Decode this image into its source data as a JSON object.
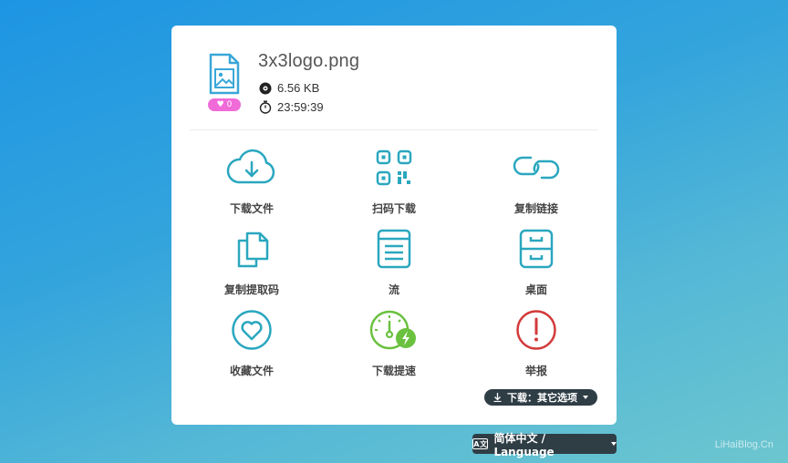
{
  "file": {
    "name": "3x3logo.png",
    "size": "6.56 KB",
    "countdown": "23:59:39",
    "likes": "0"
  },
  "actions": [
    {
      "label": "下载文件",
      "icon": "cloud-download-icon"
    },
    {
      "label": "扫码下载",
      "icon": "qr-code-icon"
    },
    {
      "label": "复制链接",
      "icon": "link-icon"
    },
    {
      "label": "复制提取码",
      "icon": "copy-icon"
    },
    {
      "label": "流",
      "icon": "document-icon"
    },
    {
      "label": "桌面",
      "icon": "cabinet-icon"
    },
    {
      "label": "收藏文件",
      "icon": "heart-icon"
    },
    {
      "label": "下载提速",
      "icon": "speedometer-icon"
    },
    {
      "label": "举报",
      "icon": "alert-icon"
    }
  ],
  "more_options_label": "下载：其它选项",
  "language_label": "简体中文 / Language",
  "watermark": "LiHaiBlog.Cn",
  "colors": {
    "teal": "#2aa7bf",
    "green": "#6ac13f",
    "red": "#d33a3a",
    "pink": "#f06ad8",
    "dark_button": "#2f3d45"
  }
}
